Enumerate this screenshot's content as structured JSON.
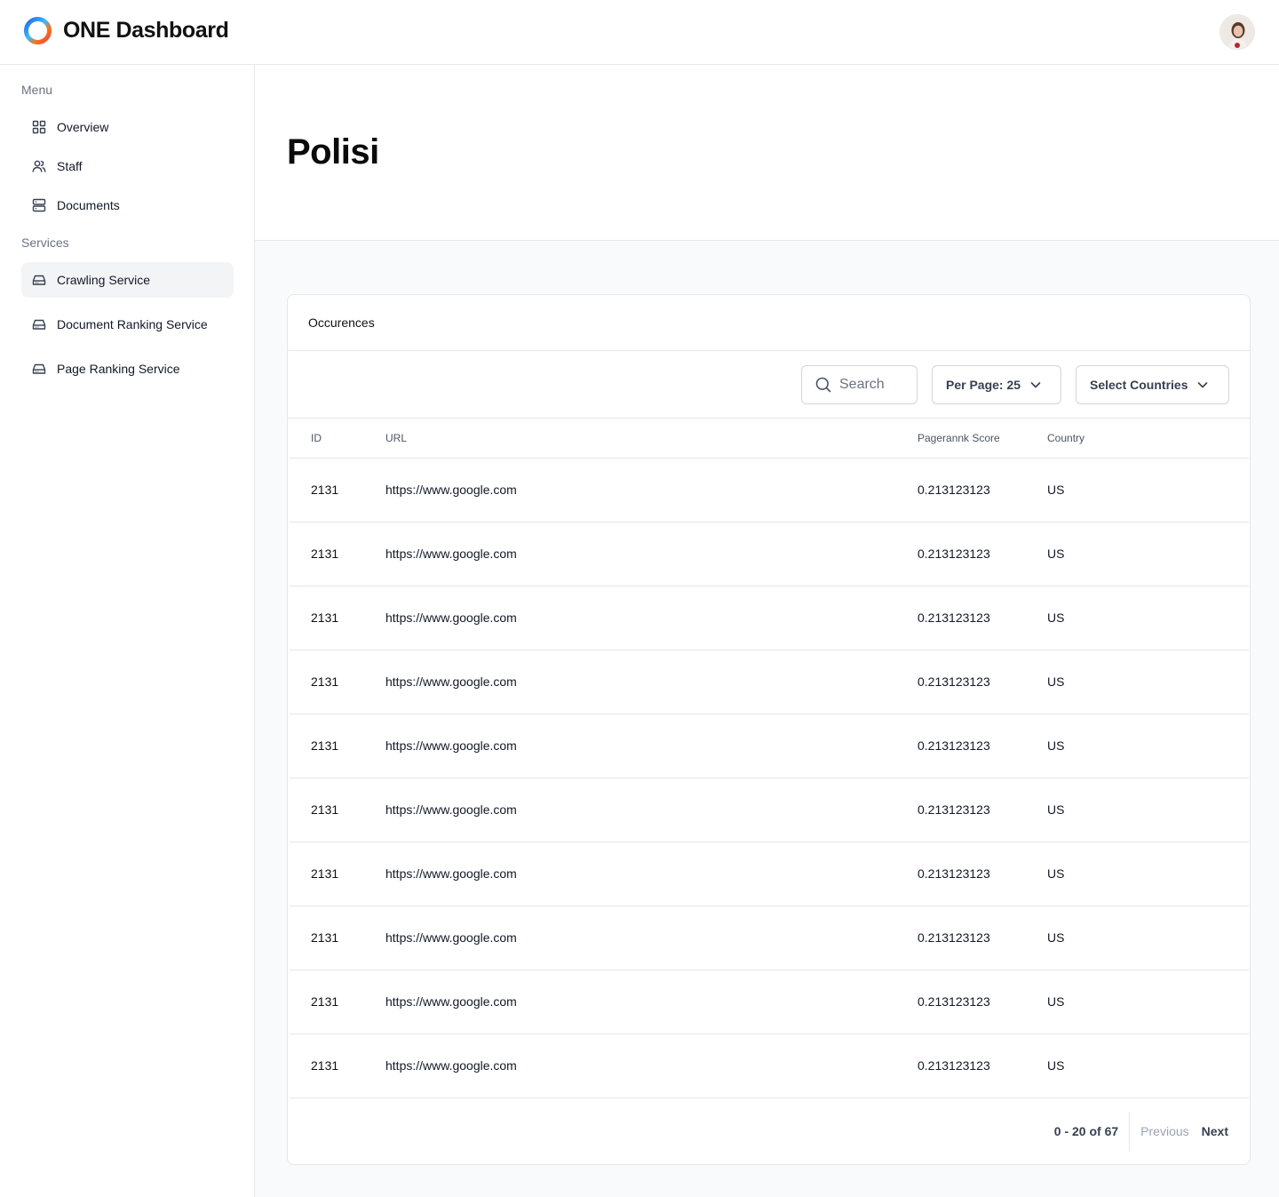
{
  "app": {
    "title": "ONE Dashboard"
  },
  "sidebar": {
    "sections": [
      {
        "label": "Menu",
        "items": [
          {
            "label": "Overview",
            "icon": "grid-icon"
          },
          {
            "label": "Staff",
            "icon": "users-icon"
          },
          {
            "label": "Documents",
            "icon": "server-icon"
          }
        ]
      },
      {
        "label": "Services",
        "items": [
          {
            "label": "Crawling Service",
            "icon": "hard-drive-icon",
            "active": true
          },
          {
            "label": "Document Ranking Service",
            "icon": "hard-drive-icon"
          },
          {
            "label": "Page Ranking Service",
            "icon": "hard-drive-icon"
          }
        ]
      }
    ]
  },
  "page": {
    "title": "Polisi"
  },
  "card": {
    "title": "Occurences",
    "search": {
      "placeholder": "Search",
      "value": ""
    },
    "per_page": {
      "label": "Per Page: 25"
    },
    "countries": {
      "label": "Select Countries"
    },
    "table": {
      "headers": {
        "id": "ID",
        "url": "URL",
        "score": "Pagerannk Score",
        "country": "Country"
      },
      "rows": [
        {
          "id": "2131",
          "url": "https://www.google.com",
          "score": "0.213123123",
          "country": "US"
        },
        {
          "id": "2131",
          "url": "https://www.google.com",
          "score": "0.213123123",
          "country": "US"
        },
        {
          "id": "2131",
          "url": "https://www.google.com",
          "score": "0.213123123",
          "country": "US"
        },
        {
          "id": "2131",
          "url": "https://www.google.com",
          "score": "0.213123123",
          "country": "US"
        },
        {
          "id": "2131",
          "url": "https://www.google.com",
          "score": "0.213123123",
          "country": "US"
        },
        {
          "id": "2131",
          "url": "https://www.google.com",
          "score": "0.213123123",
          "country": "US"
        },
        {
          "id": "2131",
          "url": "https://www.google.com",
          "score": "0.213123123",
          "country": "US"
        },
        {
          "id": "2131",
          "url": "https://www.google.com",
          "score": "0.213123123",
          "country": "US"
        },
        {
          "id": "2131",
          "url": "https://www.google.com",
          "score": "0.213123123",
          "country": "US"
        },
        {
          "id": "2131",
          "url": "https://www.google.com",
          "score": "0.213123123",
          "country": "US"
        }
      ]
    },
    "pagination": {
      "range": "0 - 20 of 67",
      "previous": "Previous",
      "next": "Next"
    }
  },
  "colors": {
    "border": "#e5e7eb",
    "content_bg": "#f9fafb",
    "active_nav_bg": "#f3f4f6",
    "muted_text": "#6b7280",
    "disabled_text": "#9ca3af"
  }
}
